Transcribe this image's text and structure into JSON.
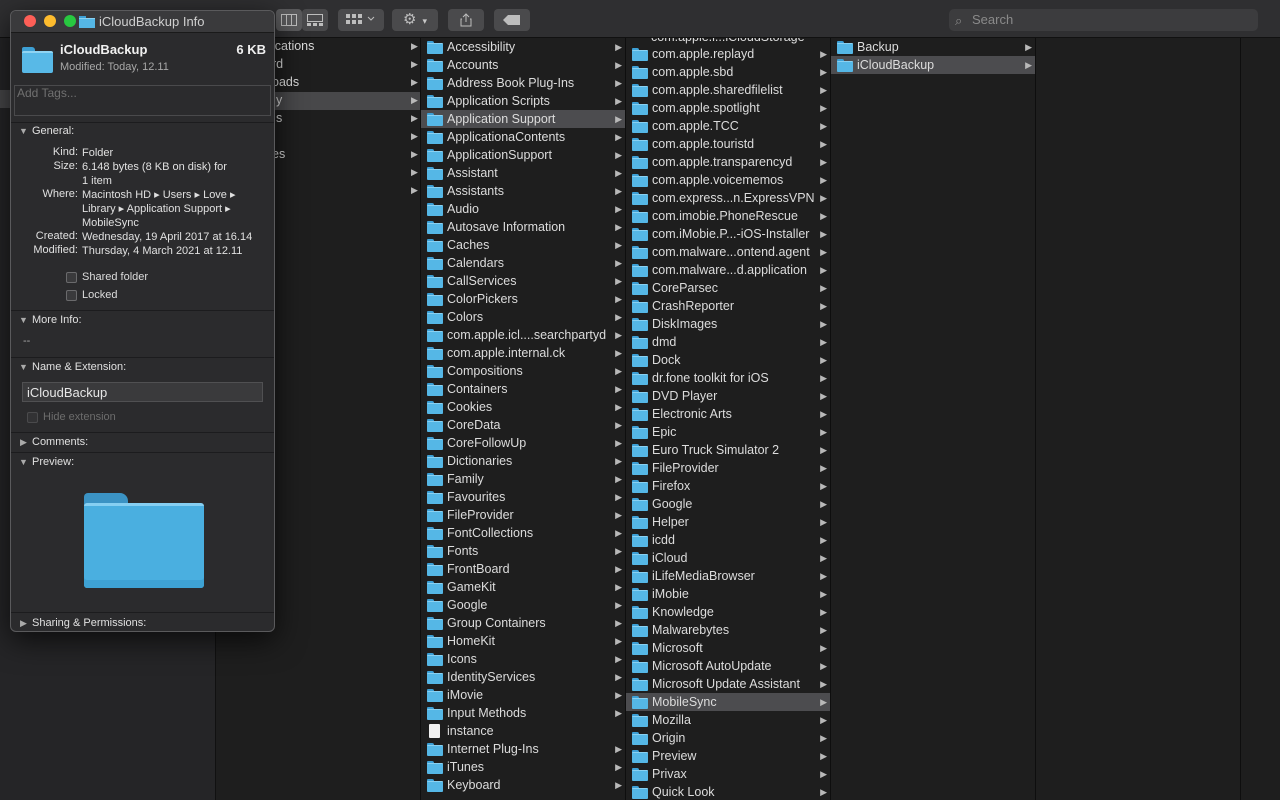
{
  "toolbar": {
    "search_placeholder": "Search",
    "search_icon": "magnifier-icon",
    "view_icons": [
      "column-view-icon",
      "gallery-view-icon",
      "group-icon",
      "gear-icon",
      "share-icon",
      "tag-icon"
    ]
  },
  "sidebar": {
    "partial_labels": [
      "ications",
      "rd",
      "oads",
      "y",
      "s",
      "es"
    ]
  },
  "columns": {
    "library": {
      "items": [
        {
          "label": "Accessibility",
          "arrow": true
        },
        {
          "label": "Accounts",
          "arrow": true
        },
        {
          "label": "Address Book Plug-Ins",
          "arrow": true
        },
        {
          "label": "Application Scripts",
          "arrow": true
        },
        {
          "label": "Application Support",
          "arrow": true,
          "selected": true
        },
        {
          "label": "ApplicationaContents",
          "arrow": true
        },
        {
          "label": "ApplicationSupport",
          "arrow": true
        },
        {
          "label": "Assistant",
          "arrow": true
        },
        {
          "label": "Assistants",
          "arrow": true
        },
        {
          "label": "Audio",
          "arrow": true
        },
        {
          "label": "Autosave Information",
          "arrow": true
        },
        {
          "label": "Caches",
          "arrow": true
        },
        {
          "label": "Calendars",
          "arrow": true
        },
        {
          "label": "CallServices",
          "arrow": true
        },
        {
          "label": "ColorPickers",
          "arrow": true
        },
        {
          "label": "Colors",
          "arrow": true
        },
        {
          "label": "com.apple.icl....searchpartyd",
          "arrow": true
        },
        {
          "label": "com.apple.internal.ck",
          "arrow": true
        },
        {
          "label": "Compositions",
          "arrow": true
        },
        {
          "label": "Containers",
          "arrow": true
        },
        {
          "label": "Cookies",
          "arrow": true
        },
        {
          "label": "CoreData",
          "arrow": true
        },
        {
          "label": "CoreFollowUp",
          "arrow": true
        },
        {
          "label": "Dictionaries",
          "arrow": true
        },
        {
          "label": "Family",
          "arrow": true
        },
        {
          "label": "Favourites",
          "arrow": true
        },
        {
          "label": "FileProvider",
          "arrow": true
        },
        {
          "label": "FontCollections",
          "arrow": true
        },
        {
          "label": "Fonts",
          "arrow": true
        },
        {
          "label": "FrontBoard",
          "arrow": true
        },
        {
          "label": "GameKit",
          "arrow": true
        },
        {
          "label": "Google",
          "arrow": true
        },
        {
          "label": "Group Containers",
          "arrow": true
        },
        {
          "label": "HomeKit",
          "arrow": true
        },
        {
          "label": "Icons",
          "arrow": true
        },
        {
          "label": "IdentityServices",
          "arrow": true
        },
        {
          "label": "iMovie",
          "arrow": true
        },
        {
          "label": "Input Methods",
          "arrow": true
        },
        {
          "label": "instance",
          "arrow": false,
          "file": true
        },
        {
          "label": "Internet Plug-Ins",
          "arrow": true
        },
        {
          "label": "iTunes",
          "arrow": true
        },
        {
          "label": "Keyboard",
          "arrow": true
        }
      ]
    },
    "appsupport": {
      "items": [
        {
          "label": "com.apple.replayd",
          "arrow": true
        },
        {
          "label": "com.apple.sbd",
          "arrow": true
        },
        {
          "label": "com.apple.sharedfilelist",
          "arrow": true
        },
        {
          "label": "com.apple.spotlight",
          "arrow": true
        },
        {
          "label": "com.apple.TCC",
          "arrow": true
        },
        {
          "label": "com.apple.touristd",
          "arrow": true
        },
        {
          "label": "com.apple.transparencyd",
          "arrow": true
        },
        {
          "label": "com.apple.voicememos",
          "arrow": true
        },
        {
          "label": "com.express...n.ExpressVPN",
          "arrow": true
        },
        {
          "label": "com.imobie.PhoneRescue",
          "arrow": true
        },
        {
          "label": "com.iMobie.P...-iOS-Installer",
          "arrow": true
        },
        {
          "label": "com.malware...ontend.agent",
          "arrow": true
        },
        {
          "label": "com.malware...d.application",
          "arrow": true
        },
        {
          "label": "CoreParsec",
          "arrow": true
        },
        {
          "label": "CrashReporter",
          "arrow": true
        },
        {
          "label": "DiskImages",
          "arrow": true
        },
        {
          "label": "dmd",
          "arrow": true
        },
        {
          "label": "Dock",
          "arrow": true
        },
        {
          "label": "dr.fone toolkit for iOS",
          "arrow": true
        },
        {
          "label": "DVD Player",
          "arrow": true
        },
        {
          "label": "Electronic Arts",
          "arrow": true
        },
        {
          "label": "Epic",
          "arrow": true
        },
        {
          "label": "Euro Truck Simulator 2",
          "arrow": true
        },
        {
          "label": "FileProvider",
          "arrow": true
        },
        {
          "label": "Firefox",
          "arrow": true
        },
        {
          "label": "Google",
          "arrow": true
        },
        {
          "label": "Helper",
          "arrow": true
        },
        {
          "label": "icdd",
          "arrow": true
        },
        {
          "label": "iCloud",
          "arrow": true
        },
        {
          "label": "iLifeMediaBrowser",
          "arrow": true
        },
        {
          "label": "iMobie",
          "arrow": true
        },
        {
          "label": "Knowledge",
          "arrow": true
        },
        {
          "label": "Malwarebytes",
          "arrow": true
        },
        {
          "label": "Microsoft",
          "arrow": true
        },
        {
          "label": "Microsoft AutoUpdate",
          "arrow": true
        },
        {
          "label": "Microsoft Update Assistant",
          "arrow": true
        },
        {
          "label": "MobileSync",
          "arrow": true,
          "selected": true
        },
        {
          "label": "Mozilla",
          "arrow": true
        },
        {
          "label": "Origin",
          "arrow": true
        },
        {
          "label": "Preview",
          "arrow": true
        },
        {
          "label": "Privax",
          "arrow": true
        },
        {
          "label": "Quick Look",
          "arrow": true
        }
      ]
    },
    "mobilesync": {
      "items": [
        {
          "label": "Backup",
          "arrow": true
        },
        {
          "label": "iCloudBackup",
          "arrow": true,
          "selected": true
        }
      ]
    }
  },
  "info": {
    "window_title": "iCloudBackup Info",
    "name": "iCloudBackup",
    "size_short": "6 KB",
    "modified_short": "Modified: Today, 12.11",
    "tags_placeholder": "Add Tags...",
    "general": {
      "header": "General:",
      "kind_k": "Kind:",
      "kind_v": "Folder",
      "size_k": "Size:",
      "size_v1": "6.148 bytes (8 KB on disk) for",
      "size_v2": "1 item",
      "where_k": "Where:",
      "where_v1": "Macintosh HD ▸ Users ▸ Love ▸",
      "where_v2": "Library ▸ Application Support ▸",
      "where_v3": "MobileSync",
      "created_k": "Created:",
      "created_v": "Wednesday, 19 April 2017 at 16.14",
      "modified_k": "Modified:",
      "modified_v": "Thursday, 4 March 2021 at 12.11",
      "shared": "Shared folder",
      "locked": "Locked"
    },
    "more_info": {
      "header": "More Info:",
      "value": "--"
    },
    "name_ext": {
      "header": "Name & Extension:",
      "value": "iCloudBackup",
      "hide_ext": "Hide extension"
    },
    "comments": {
      "header": "Comments:"
    },
    "preview": {
      "header": "Preview:"
    },
    "sharing": {
      "header": "Sharing & Permissions:"
    }
  }
}
